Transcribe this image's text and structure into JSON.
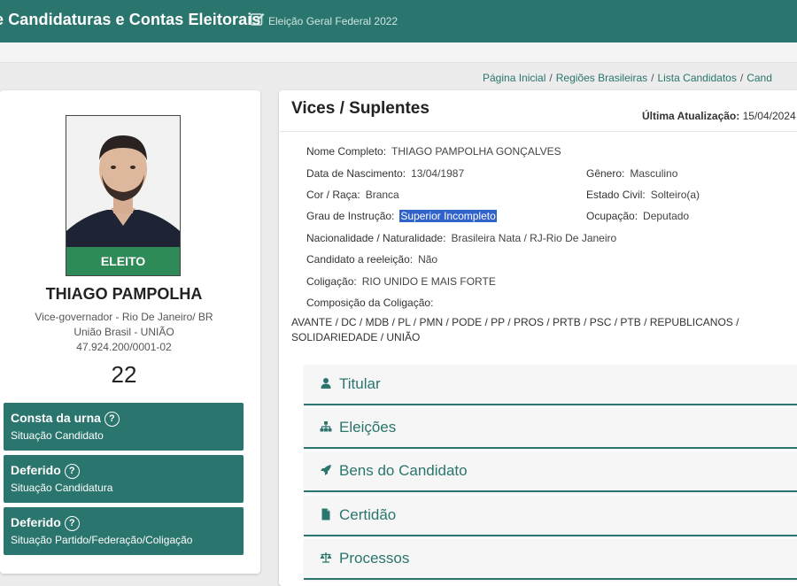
{
  "header": {
    "title": "e Candidaturas e Contas Eleitorais",
    "election": "Eleição Geral Federal 2022",
    "edit_icon": "edit-square-icon"
  },
  "breadcrumb": {
    "items": [
      "Página Inicial",
      "Regiões Brasileiras",
      "Lista Candidatos",
      "Cand"
    ]
  },
  "profile": {
    "photo_badge": "ELEITO",
    "name": "THIAGO PAMPOLHA",
    "office": "Vice-governador - Rio De Janeiro/ BR",
    "party": "União Brasil - UNIÃO",
    "cnpj": "47.924.200/0001-02",
    "number": "22",
    "statuses": [
      {
        "title": "Consta da urna",
        "subtitle": "Situação Candidato"
      },
      {
        "title": "Deferido",
        "subtitle": "Situação Candidatura"
      },
      {
        "title": "Deferido",
        "subtitle": "Situação Partido/Federação/Coligação"
      }
    ],
    "help_glyph": "?"
  },
  "main": {
    "title": "Vices / Suplentes",
    "updated_label": "Última Atualização:",
    "updated_value": "15/04/2024",
    "fields": {
      "nome_completo": {
        "label": "Nome Completo:",
        "value": "THIAGO PAMPOLHA GONÇALVES"
      },
      "nascimento": {
        "label": "Data de Nascimento:",
        "value": "13/04/1987"
      },
      "genero": {
        "label": "Gênero:",
        "value": "Masculino"
      },
      "cor_raca": {
        "label": "Cor / Raça:",
        "value": "Branca"
      },
      "estado_civil": {
        "label": "Estado Civil:",
        "value": "Solteiro(a)"
      },
      "instrucao": {
        "label": "Grau de Instrução:",
        "value": "Superior Incompleto"
      },
      "ocupacao": {
        "label": "Ocupação:",
        "value": "Deputado"
      },
      "nacionalidade": {
        "label": "Nacionalidade / Naturalidade:",
        "value": "Brasileira Nata / RJ-Rio De Janeiro"
      },
      "reeleicao": {
        "label": "Candidato a reeleição:",
        "value": "Não"
      },
      "coligacao": {
        "label": "Coligação:",
        "value": "RIO UNIDO E MAIS FORTE"
      },
      "composicao": {
        "label": "Composição da Coligação:"
      }
    },
    "parties": "AVANTE / DC / MDB / PL / PMN / PODE / PP / PROS / PRTB / PSC / PTB / REPUBLICANOS / SOLIDARIEDADE / UNIÃO",
    "accordions": [
      {
        "label": "Titular",
        "icon": "user-icon"
      },
      {
        "label": "Eleições",
        "icon": "sitemap-icon"
      },
      {
        "label": "Bens do Candidato",
        "icon": "rocket-icon"
      },
      {
        "label": "Certidão",
        "icon": "document-icon"
      },
      {
        "label": "Processos",
        "icon": "scale-icon"
      }
    ]
  },
  "colors": {
    "primary": "#2a756d",
    "badge": "#2e8a56",
    "highlight": "#2f63c9"
  }
}
